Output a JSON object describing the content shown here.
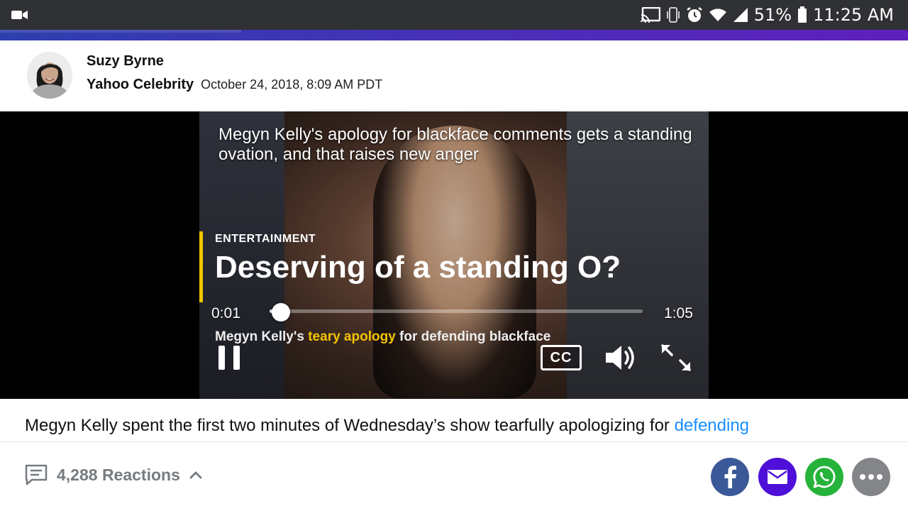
{
  "status_bar": {
    "battery": "51%",
    "time": "11:25 AM",
    "icons": [
      "video-camera-icon",
      "cast-icon",
      "vibrate-icon",
      "alarm-icon",
      "wifi-icon",
      "signal-icon",
      "battery-icon"
    ]
  },
  "byline": {
    "author": "Suzy Byrne",
    "publisher": "Yahoo Celebrity",
    "date": "October 24, 2018, 8:09 AM PDT"
  },
  "video": {
    "title": "Megyn Kelly's apology for blackface comments gets a standing ovation, and that raises new anger",
    "category": "ENTERTAINMENT",
    "headline": "Deserving of a standing O?",
    "subline_before": "Megyn Kelly's ",
    "subline_highlight": "teary apology",
    "subline_after": " for defending blackface",
    "current_time": "0:01",
    "duration": "1:05",
    "progress": 0.03,
    "cc_label": "CC",
    "controls": [
      "pause-icon",
      "closed-captions-icon",
      "volume-icon",
      "fullscreen-icon"
    ]
  },
  "article": {
    "text": "Megyn Kelly spent the first two minutes of Wednesday’s show tearfully apologizing for ",
    "link": "defending"
  },
  "reactions": {
    "count_label": "4,288 Reactions"
  },
  "share": {
    "buttons": [
      "facebook-icon",
      "email-icon",
      "whatsapp-icon",
      "more-icon"
    ]
  },
  "colors": {
    "accent_gradient_start": "#2d3fae",
    "accent_gradient_end": "#5f1fbd",
    "link": "#188fff",
    "highlight": "#f5c400",
    "facebook": "#3b5998",
    "mail": "#4e0fd9",
    "whatsapp": "#25b33a",
    "more": "#838589"
  }
}
